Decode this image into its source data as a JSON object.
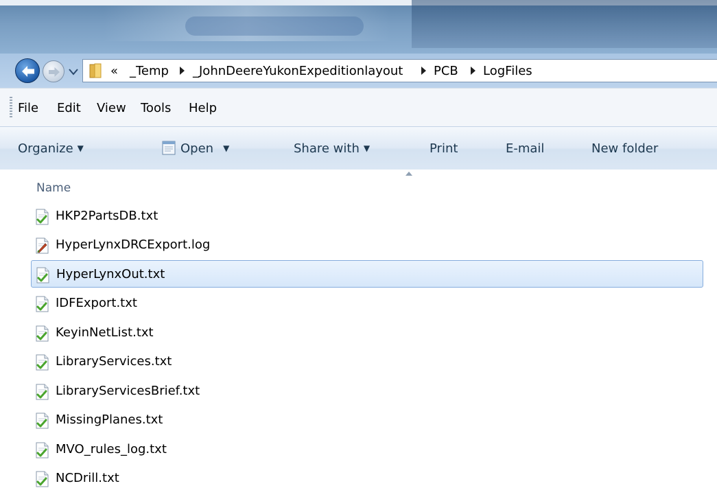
{
  "address_bar": {
    "overflow": "«",
    "crumbs": [
      "_Temp",
      "_JohnDeereYukonExpeditionlayout",
      "PCB",
      "LogFiles"
    ]
  },
  "menu": {
    "file": "File",
    "edit": "Edit",
    "view": "View",
    "tools": "Tools",
    "help": "Help"
  },
  "toolbar": {
    "organize": "Organize",
    "open": "Open",
    "share_with": "Share with",
    "print": "Print",
    "email": "E-mail",
    "new_folder": "New folder"
  },
  "list": {
    "column_name": "Name",
    "files": [
      {
        "name": "HKP2PartsDB.txt",
        "icon": "text-file-icon"
      },
      {
        "name": "HyperLynxDRCExport.log",
        "icon": "log-file-icon"
      },
      {
        "name": "HyperLynxOut.txt",
        "icon": "text-file-icon",
        "selected": true
      },
      {
        "name": "IDFExport.txt",
        "icon": "text-file-icon"
      },
      {
        "name": "KeyinNetList.txt",
        "icon": "text-file-icon"
      },
      {
        "name": "LibraryServices.txt",
        "icon": "text-file-icon"
      },
      {
        "name": "LibraryServicesBrief.txt",
        "icon": "text-file-icon"
      },
      {
        "name": "MissingPlanes.txt",
        "icon": "text-file-icon"
      },
      {
        "name": "MVO_rules_log.txt",
        "icon": "text-file-icon"
      },
      {
        "name": "NCDrill.txt",
        "icon": "text-file-icon"
      }
    ]
  },
  "colors": {
    "selection_fill": "#d6e7fa",
    "selection_border": "#84acdd",
    "command_text": "#1e3950"
  }
}
